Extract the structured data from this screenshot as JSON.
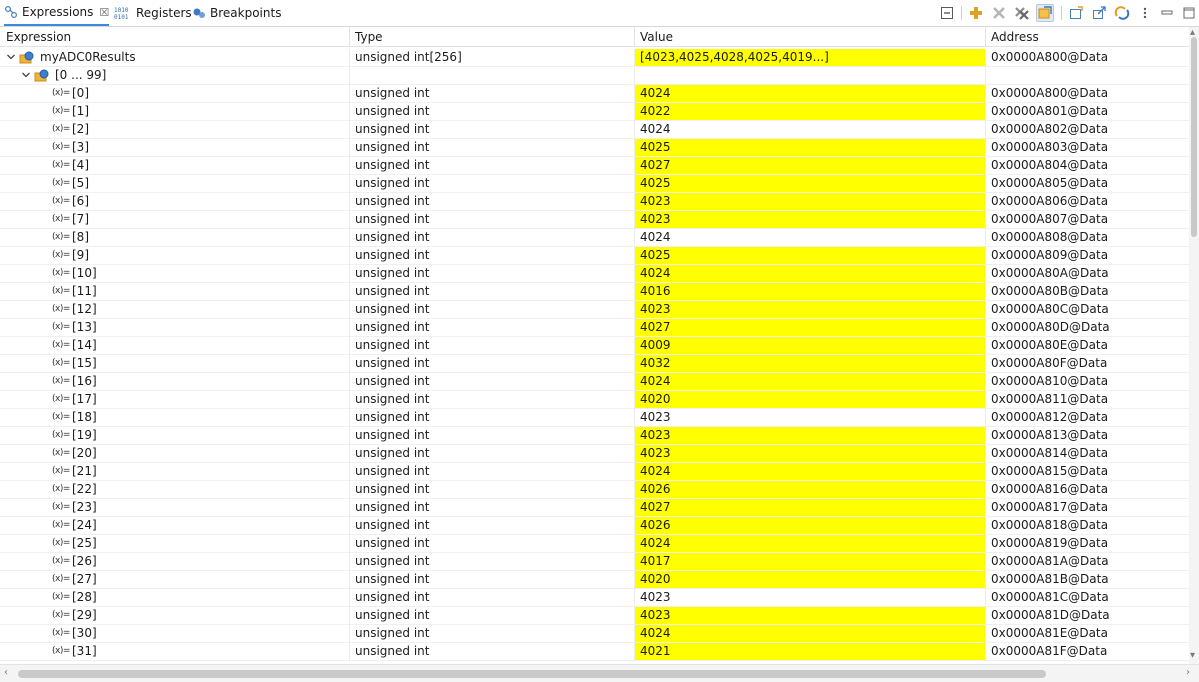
{
  "tabs": [
    {
      "label": "Expressions",
      "icon": "expressions-icon",
      "active": true,
      "closable": true
    },
    {
      "label": "Registers",
      "icon": "registers-icon",
      "active": false
    },
    {
      "label": "Breakpoints",
      "icon": "breakpoints-icon",
      "active": false
    }
  ],
  "toolbar": [
    {
      "name": "minimize-view-icon"
    },
    {
      "name": "add-expression-icon"
    },
    {
      "name": "remove-expression-icon"
    },
    {
      "name": "remove-all-icon"
    },
    {
      "name": "collapse-all-icon",
      "pressed": true
    },
    {
      "name": "new-expression-icon"
    },
    {
      "name": "export-icon"
    },
    {
      "name": "refresh-icon"
    },
    {
      "name": "view-menu-icon"
    },
    {
      "name": "minimize-icon"
    },
    {
      "name": "maximize-icon"
    }
  ],
  "columns": {
    "expression": "Expression",
    "type": "Type",
    "value": "Value",
    "address": "Address"
  },
  "root": {
    "name": "myADC0Results",
    "type": "unsigned int[256]",
    "value": "[4023,4025,4028,4025,4019...]",
    "value_changed": true,
    "address": "0x0000A800@Data",
    "expanded": true
  },
  "group": {
    "label": "[0 ... 99]",
    "expanded": true
  },
  "element_type": "unsigned int",
  "variable_glyph": "(x)=",
  "elements": [
    {
      "index": "[0]",
      "value": "4024",
      "changed": true,
      "address": "0x0000A800@Data"
    },
    {
      "index": "[1]",
      "value": "4022",
      "changed": true,
      "address": "0x0000A801@Data"
    },
    {
      "index": "[2]",
      "value": "4024",
      "changed": false,
      "address": "0x0000A802@Data"
    },
    {
      "index": "[3]",
      "value": "4025",
      "changed": true,
      "address": "0x0000A803@Data"
    },
    {
      "index": "[4]",
      "value": "4027",
      "changed": true,
      "address": "0x0000A804@Data"
    },
    {
      "index": "[5]",
      "value": "4025",
      "changed": true,
      "address": "0x0000A805@Data"
    },
    {
      "index": "[6]",
      "value": "4023",
      "changed": true,
      "address": "0x0000A806@Data"
    },
    {
      "index": "[7]",
      "value": "4023",
      "changed": true,
      "address": "0x0000A807@Data"
    },
    {
      "index": "[8]",
      "value": "4024",
      "changed": false,
      "address": "0x0000A808@Data"
    },
    {
      "index": "[9]",
      "value": "4025",
      "changed": true,
      "address": "0x0000A809@Data"
    },
    {
      "index": "[10]",
      "value": "4024",
      "changed": true,
      "address": "0x0000A80A@Data"
    },
    {
      "index": "[11]",
      "value": "4016",
      "changed": true,
      "address": "0x0000A80B@Data"
    },
    {
      "index": "[12]",
      "value": "4023",
      "changed": true,
      "address": "0x0000A80C@Data"
    },
    {
      "index": "[13]",
      "value": "4027",
      "changed": true,
      "address": "0x0000A80D@Data"
    },
    {
      "index": "[14]",
      "value": "4009",
      "changed": true,
      "address": "0x0000A80E@Data"
    },
    {
      "index": "[15]",
      "value": "4032",
      "changed": true,
      "address": "0x0000A80F@Data"
    },
    {
      "index": "[16]",
      "value": "4024",
      "changed": true,
      "address": "0x0000A810@Data"
    },
    {
      "index": "[17]",
      "value": "4020",
      "changed": true,
      "address": "0x0000A811@Data"
    },
    {
      "index": "[18]",
      "value": "4023",
      "changed": false,
      "address": "0x0000A812@Data"
    },
    {
      "index": "[19]",
      "value": "4023",
      "changed": true,
      "address": "0x0000A813@Data"
    },
    {
      "index": "[20]",
      "value": "4023",
      "changed": true,
      "address": "0x0000A814@Data"
    },
    {
      "index": "[21]",
      "value": "4024",
      "changed": true,
      "address": "0x0000A815@Data"
    },
    {
      "index": "[22]",
      "value": "4026",
      "changed": true,
      "address": "0x0000A816@Data"
    },
    {
      "index": "[23]",
      "value": "4027",
      "changed": true,
      "address": "0x0000A817@Data"
    },
    {
      "index": "[24]",
      "value": "4026",
      "changed": true,
      "address": "0x0000A818@Data"
    },
    {
      "index": "[25]",
      "value": "4024",
      "changed": true,
      "address": "0x0000A819@Data"
    },
    {
      "index": "[26]",
      "value": "4017",
      "changed": true,
      "address": "0x0000A81A@Data"
    },
    {
      "index": "[27]",
      "value": "4020",
      "changed": true,
      "address": "0x0000A81B@Data"
    },
    {
      "index": "[28]",
      "value": "4023",
      "changed": false,
      "address": "0x0000A81C@Data"
    },
    {
      "index": "[29]",
      "value": "4023",
      "changed": true,
      "address": "0x0000A81D@Data"
    },
    {
      "index": "[30]",
      "value": "4024",
      "changed": true,
      "address": "0x0000A81E@Data"
    },
    {
      "index": "[31]",
      "value": "4021",
      "changed": true,
      "address": "0x0000A81F@Data"
    }
  ],
  "colors": {
    "changed_highlight": "#ffff00",
    "active_tab_underline": "#3a8bdc",
    "variable_icon_blue": "#2f6fb5",
    "folder_yellow": "#f2b23a"
  }
}
